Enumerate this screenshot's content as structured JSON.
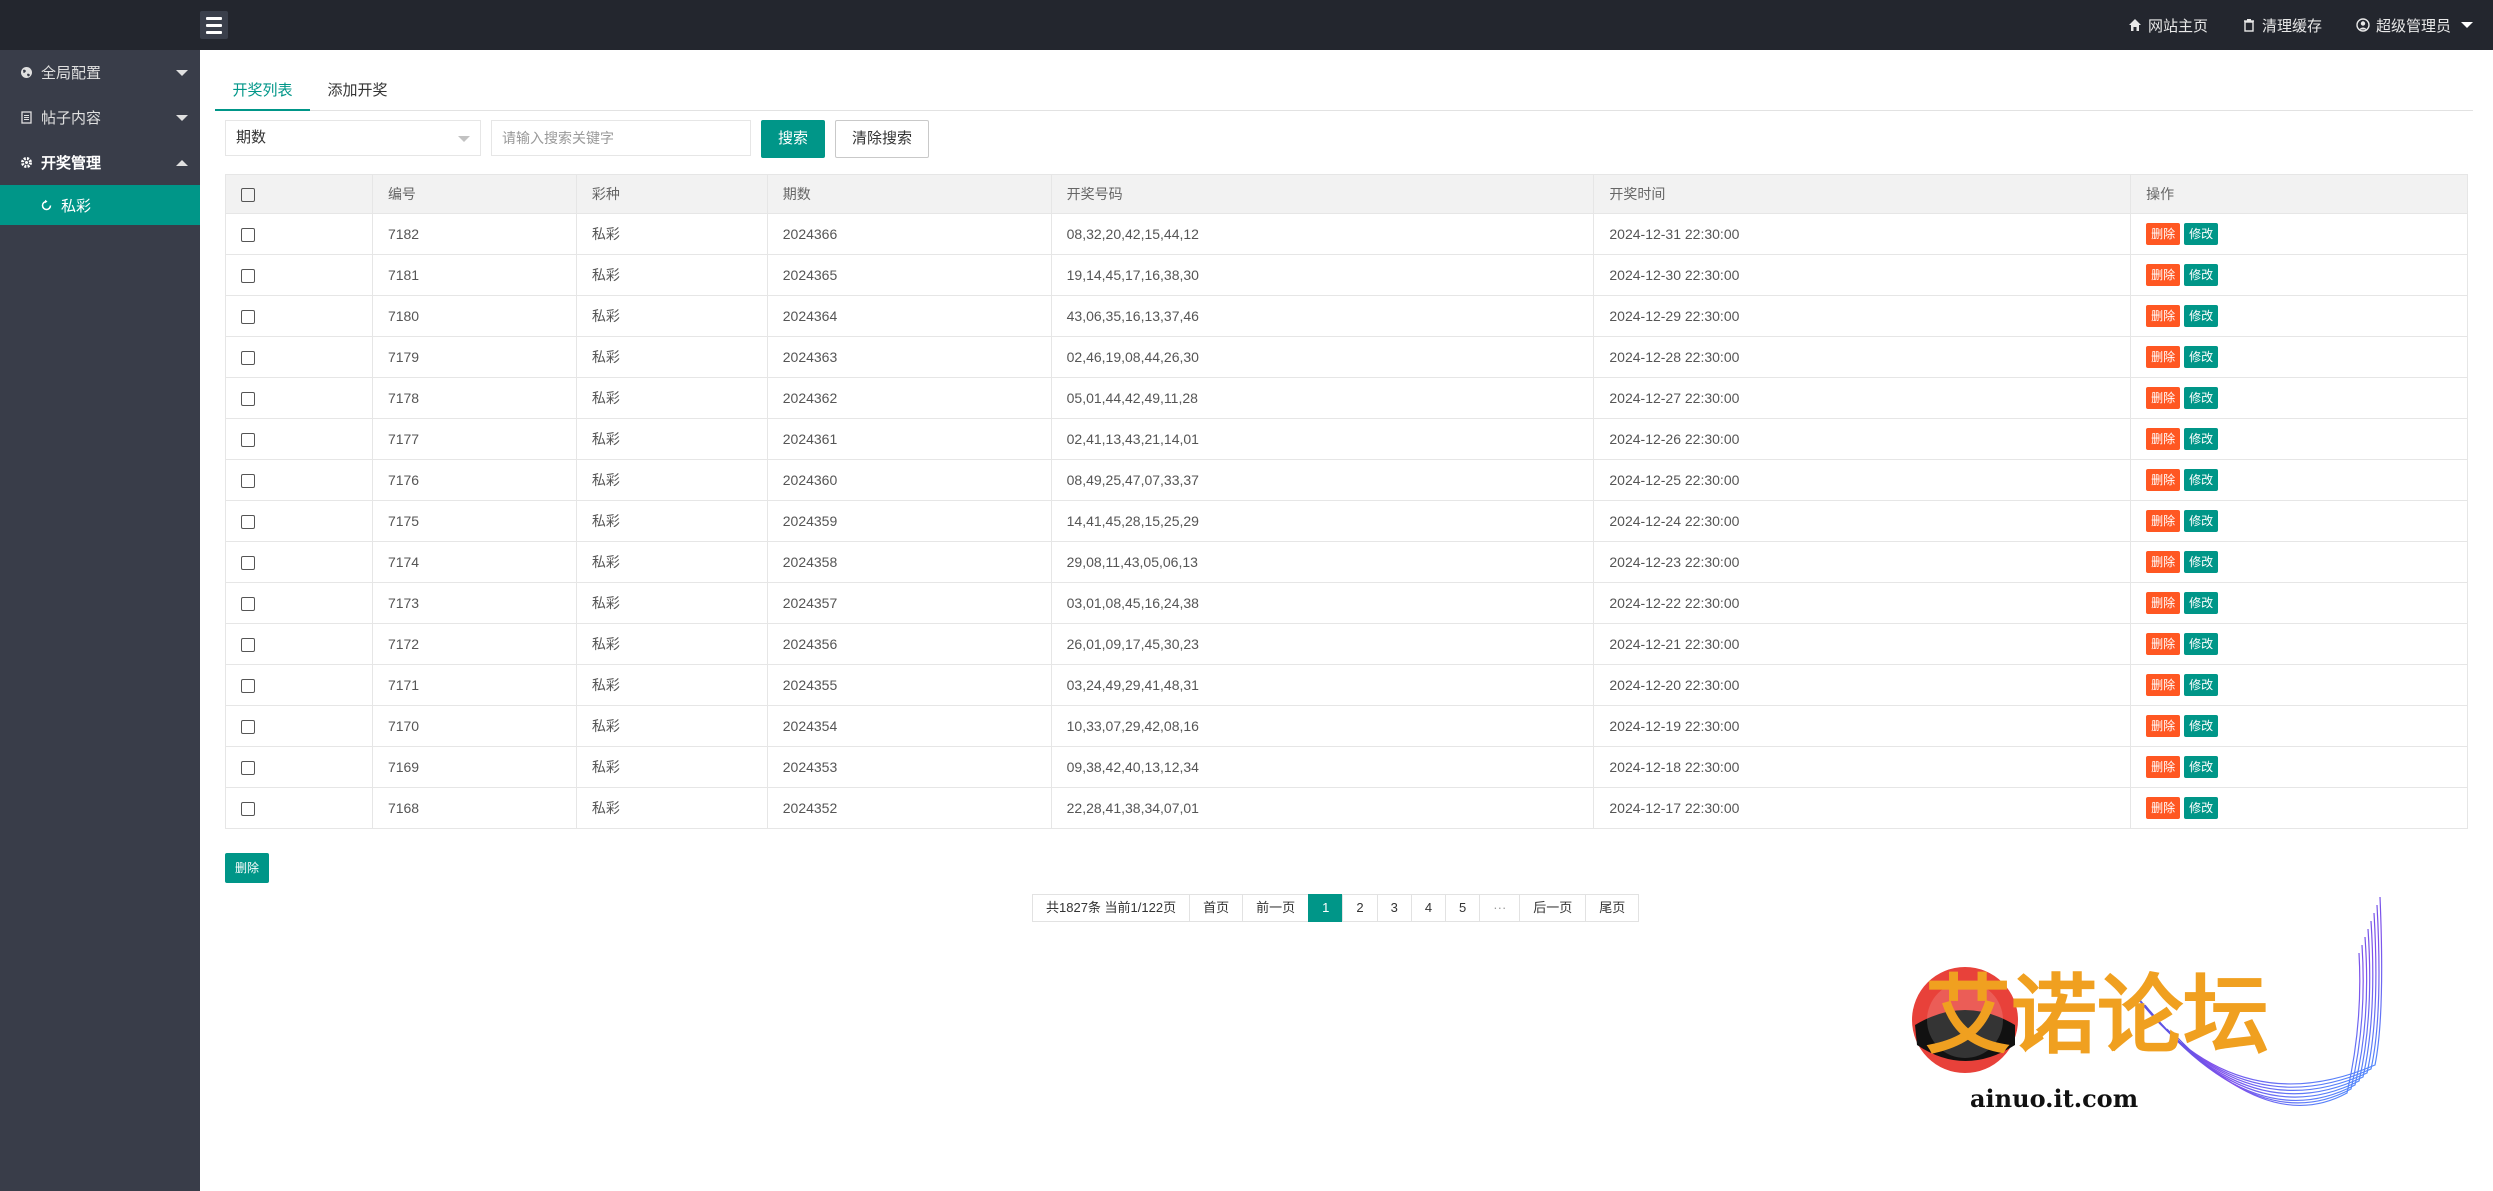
{
  "topbar": {
    "nav": [
      {
        "icon": "home-icon",
        "label": "网站主页"
      },
      {
        "icon": "trash-icon",
        "label": "清理缓存"
      },
      {
        "icon": "user-circle-icon",
        "label": "超级管理员"
      }
    ]
  },
  "sidebar": {
    "items": [
      {
        "icon": "globe-icon",
        "label": "全局配置"
      },
      {
        "icon": "document-icon",
        "label": "帖子内容"
      },
      {
        "icon": "gear-icon",
        "label": "开奖管理"
      }
    ],
    "sub": {
      "icon": "refresh-icon",
      "label": "私彩"
    }
  },
  "tabs": [
    "开奖列表",
    "添加开奖"
  ],
  "search": {
    "field_selected": "期数",
    "placeholder": "请输入搜索关键字",
    "search_label": "搜索",
    "clear_label": "清除搜索"
  },
  "table": {
    "columns": [
      "编号",
      "彩种",
      "期数",
      "开奖号码",
      "开奖时间",
      "操作"
    ],
    "delete_label": "删除",
    "edit_label": "修改",
    "rows": [
      {
        "id": "7182",
        "kind": "私彩",
        "period": "2024366",
        "numbers": "08,32,20,42,15,44,12",
        "time": "2024-12-31 22:30:00"
      },
      {
        "id": "7181",
        "kind": "私彩",
        "period": "2024365",
        "numbers": "19,14,45,17,16,38,30",
        "time": "2024-12-30 22:30:00"
      },
      {
        "id": "7180",
        "kind": "私彩",
        "period": "2024364",
        "numbers": "43,06,35,16,13,37,46",
        "time": "2024-12-29 22:30:00"
      },
      {
        "id": "7179",
        "kind": "私彩",
        "period": "2024363",
        "numbers": "02,46,19,08,44,26,30",
        "time": "2024-12-28 22:30:00"
      },
      {
        "id": "7178",
        "kind": "私彩",
        "period": "2024362",
        "numbers": "05,01,44,42,49,11,28",
        "time": "2024-12-27 22:30:00"
      },
      {
        "id": "7177",
        "kind": "私彩",
        "period": "2024361",
        "numbers": "02,41,13,43,21,14,01",
        "time": "2024-12-26 22:30:00"
      },
      {
        "id": "7176",
        "kind": "私彩",
        "period": "2024360",
        "numbers": "08,49,25,47,07,33,37",
        "time": "2024-12-25 22:30:00"
      },
      {
        "id": "7175",
        "kind": "私彩",
        "period": "2024359",
        "numbers": "14,41,45,28,15,25,29",
        "time": "2024-12-24 22:30:00"
      },
      {
        "id": "7174",
        "kind": "私彩",
        "period": "2024358",
        "numbers": "29,08,11,43,05,06,13",
        "time": "2024-12-23 22:30:00"
      },
      {
        "id": "7173",
        "kind": "私彩",
        "period": "2024357",
        "numbers": "03,01,08,45,16,24,38",
        "time": "2024-12-22 22:30:00"
      },
      {
        "id": "7172",
        "kind": "私彩",
        "period": "2024356",
        "numbers": "26,01,09,17,45,30,23",
        "time": "2024-12-21 22:30:00"
      },
      {
        "id": "7171",
        "kind": "私彩",
        "period": "2024355",
        "numbers": "03,24,49,29,41,48,31",
        "time": "2024-12-20 22:30:00"
      },
      {
        "id": "7170",
        "kind": "私彩",
        "period": "2024354",
        "numbers": "10,33,07,29,42,08,16",
        "time": "2024-12-19 22:30:00"
      },
      {
        "id": "7169",
        "kind": "私彩",
        "period": "2024353",
        "numbers": "09,38,42,40,13,12,34",
        "time": "2024-12-18 22:30:00"
      },
      {
        "id": "7168",
        "kind": "私彩",
        "period": "2024352",
        "numbers": "22,28,41,38,34,07,01",
        "time": "2024-12-17 22:30:00"
      }
    ]
  },
  "bulk_delete_label": "删除",
  "pagination": {
    "summary": "共1827条 当前1/122页",
    "first": "首页",
    "prev": "前一页",
    "pages": [
      "1",
      "2",
      "3",
      "4",
      "5"
    ],
    "current": "1",
    "ellipsis": "···",
    "next": "后一页",
    "last": "尾页"
  },
  "watermark": {
    "title": "艾诺论坛",
    "domain": "ainuo.it.com"
  },
  "colors": {
    "primary": "#009688",
    "danger": "#ff5722",
    "topbar": "#23262e",
    "sidebar": "#393d49"
  }
}
